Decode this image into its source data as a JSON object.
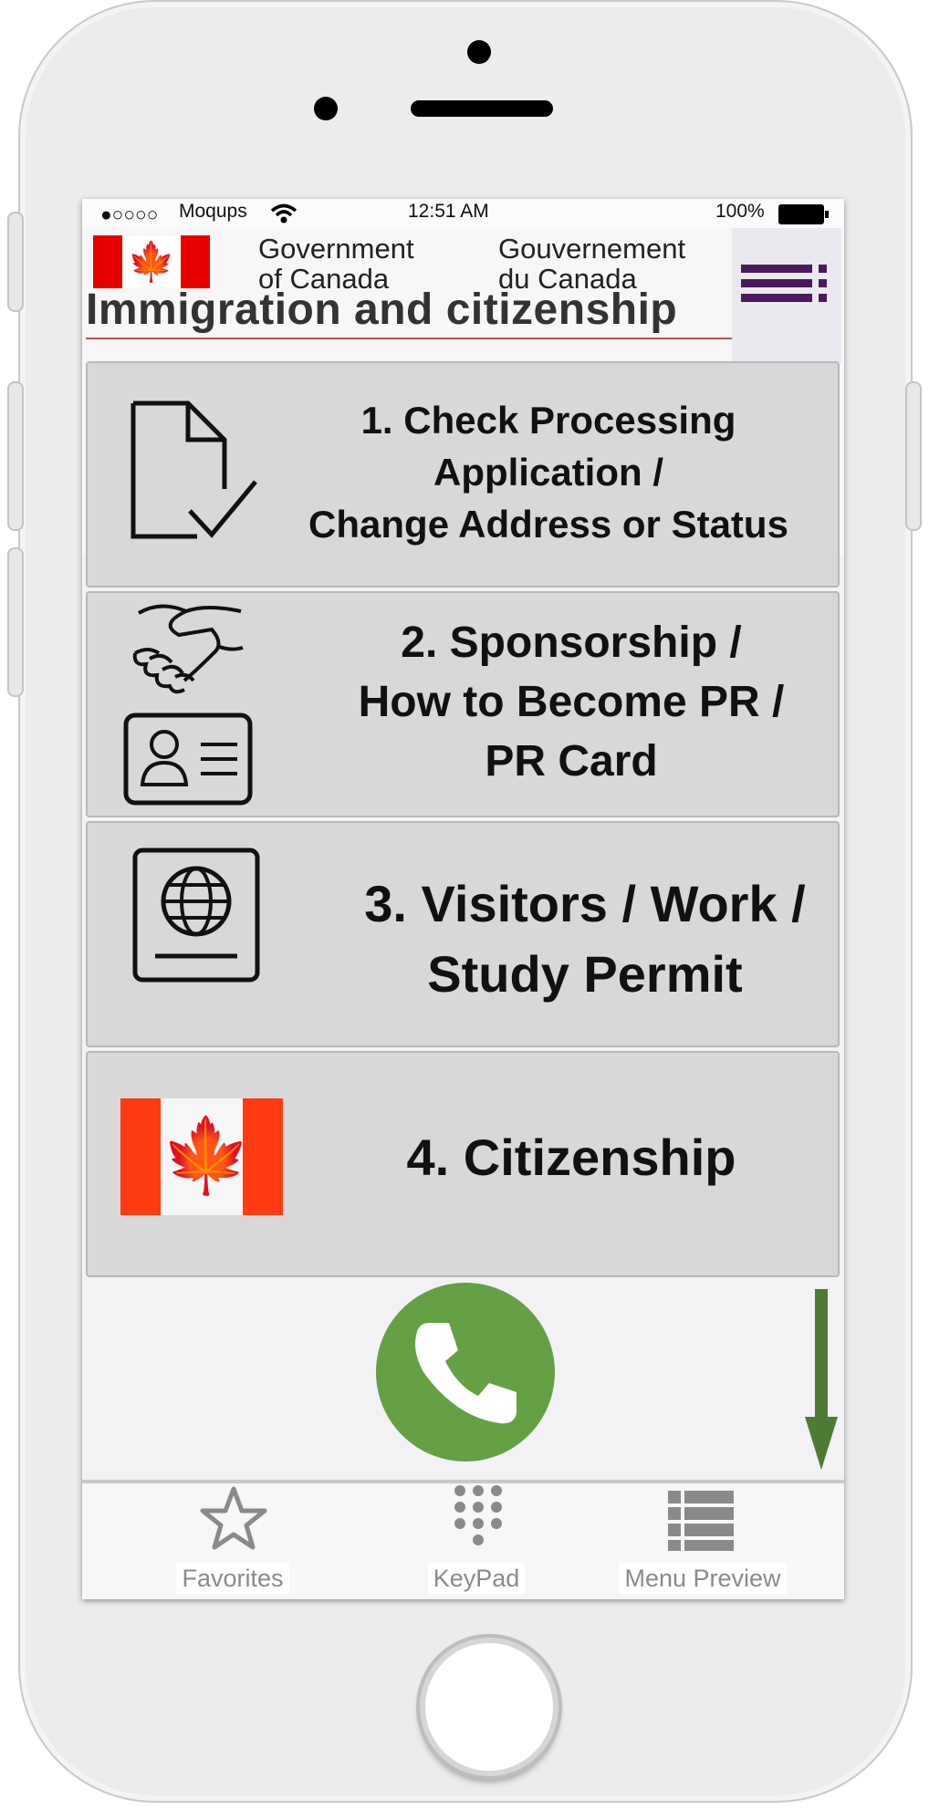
{
  "status_bar": {
    "signal": "●○○○○",
    "carrier": "Moqups",
    "time": "12:51 AM",
    "battery_percent": "100%"
  },
  "header": {
    "gov_en_line1": "Government",
    "gov_en_line2": "of Canada",
    "gov_fr_line1": "Gouvernement",
    "gov_fr_line2": "du Canada",
    "title": "Immigration and citizenship",
    "menu_icon": "hamburger-menu-icon"
  },
  "menu_cards": [
    {
      "lines": [
        "1. Check Processing",
        "Application /",
        "Change Address or Status"
      ],
      "icon": "document-check-icon"
    },
    {
      "lines": [
        "2. Sponsorship /",
        "How to Become PR /",
        "PR Card"
      ],
      "icon": "handshake-id-card-icon"
    },
    {
      "lines": [
        "3. Visitors / Work /",
        "Study Permit"
      ],
      "icon": "passport-icon"
    },
    {
      "lines": [
        "4. Citizenship"
      ],
      "icon": "canada-flag-icon"
    }
  ],
  "call_button": {
    "icon": "phone-icon",
    "color": "#64a044"
  },
  "tab_bar": {
    "tabs": [
      {
        "label": "Favorites",
        "icon": "star-icon"
      },
      {
        "label": "KeyPad",
        "icon": "keypad-icon"
      },
      {
        "label": "Menu Preview",
        "icon": "list-icon"
      }
    ]
  },
  "colors": {
    "accent_purple": "#4a1a5c",
    "flag_red": "#e70000",
    "arrow_green": "#4e7a34"
  }
}
